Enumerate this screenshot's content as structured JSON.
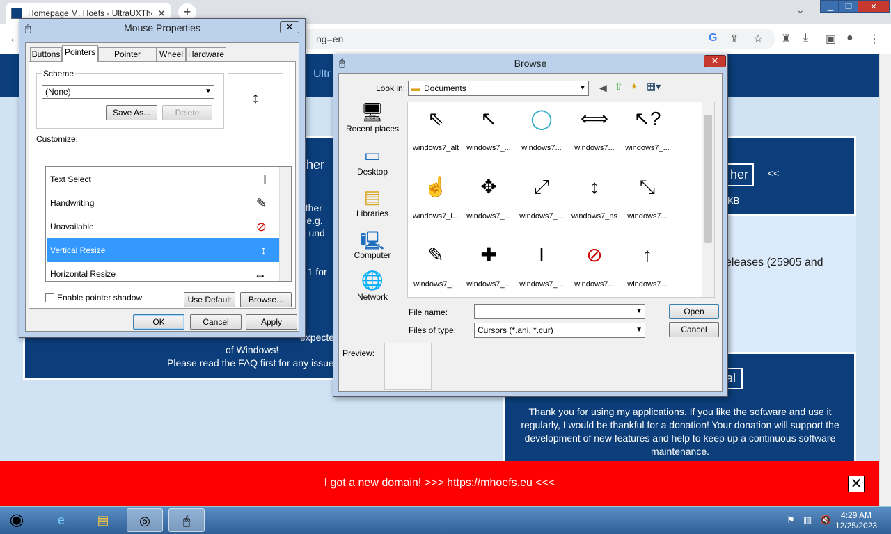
{
  "browser": {
    "tab_title": "Homepage M. Hoefs - UltraUXThemePatcher",
    "address": "ng=en",
    "nav_text": "Ultr"
  },
  "page": {
    "card1_title": "her",
    "card1_frags": [
      "ty ther",
      "n (e.g.",
      "be und",
      "s 11 for"
    ],
    "card1_lines": [
      "expecte",
      "of Windows!",
      "Please read the FAQ first for any issues"
    ],
    "card2_title": "her",
    "card2_sub": "KB",
    "card2_nav": "<<",
    "card2b_text": "eleases (25905 and",
    "card3_title": "al",
    "card3_text": "Thank you for using my applications. If you like the software and use it regularly, I would be thankful for a donation! Your donation will support the development of new features and help to keep up a continuous software maintenance.",
    "banner": "I got a new domain! >>> https://mhoefs.eu <<<"
  },
  "mouse": {
    "title": "Mouse Properties",
    "tabs": [
      "Buttons",
      "Pointers",
      "Pointer Options",
      "Wheel",
      "Hardware"
    ],
    "scheme_label": "Scheme",
    "scheme_value": "(None)",
    "save_as": "Save As...",
    "delete": "Delete",
    "customize": "Customize:",
    "rows": [
      {
        "label": "Text Select",
        "icon": "I"
      },
      {
        "label": "Handwriting",
        "icon": "✎"
      },
      {
        "label": "Unavailable",
        "icon": "⊘"
      },
      {
        "label": "Vertical Resize",
        "icon": "↕"
      },
      {
        "label": "Horizontal Resize",
        "icon": "↔"
      }
    ],
    "shadow": "Enable pointer shadow",
    "use_default": "Use Default",
    "browse": "Browse...",
    "ok": "OK",
    "cancel": "Cancel",
    "apply": "Apply"
  },
  "browse": {
    "title": "Browse",
    "look_in_label": "Look in:",
    "look_in": "Documents",
    "places": [
      "Recent places",
      "Desktop",
      "Libraries",
      "Computer",
      "Network"
    ],
    "files": [
      {
        "name": "windows7_alt",
        "icon": "⇖"
      },
      {
        "name": "windows7_...",
        "icon": "↖"
      },
      {
        "name": "windows7...",
        "icon": "◯"
      },
      {
        "name": "windows7...",
        "icon": "⟺"
      },
      {
        "name": "windows7_...",
        "icon": "↖?"
      },
      {
        "name": "windows7_l...",
        "icon": "☝"
      },
      {
        "name": "windows7_...",
        "icon": "✥"
      },
      {
        "name": "windows7_...",
        "icon": "⤢"
      },
      {
        "name": "windows7_ns",
        "icon": "↕"
      },
      {
        "name": "windows7...",
        "icon": "⤡"
      },
      {
        "name": "windows7_...",
        "icon": "✎"
      },
      {
        "name": "windows7_...",
        "icon": "✚"
      },
      {
        "name": "windows7_...",
        "icon": "I"
      },
      {
        "name": "windows7...",
        "icon": "⊘"
      },
      {
        "name": "windows7...",
        "icon": "↑"
      }
    ],
    "file_name_label": "File name:",
    "file_name": "",
    "type_label": "Files of type:",
    "type_value": "Cursors (*.ani, *.cur)",
    "open": "Open",
    "cancel": "Cancel",
    "preview_label": "Preview:"
  },
  "taskbar": {
    "time": "4:29 AM",
    "date": "12/25/2023"
  }
}
